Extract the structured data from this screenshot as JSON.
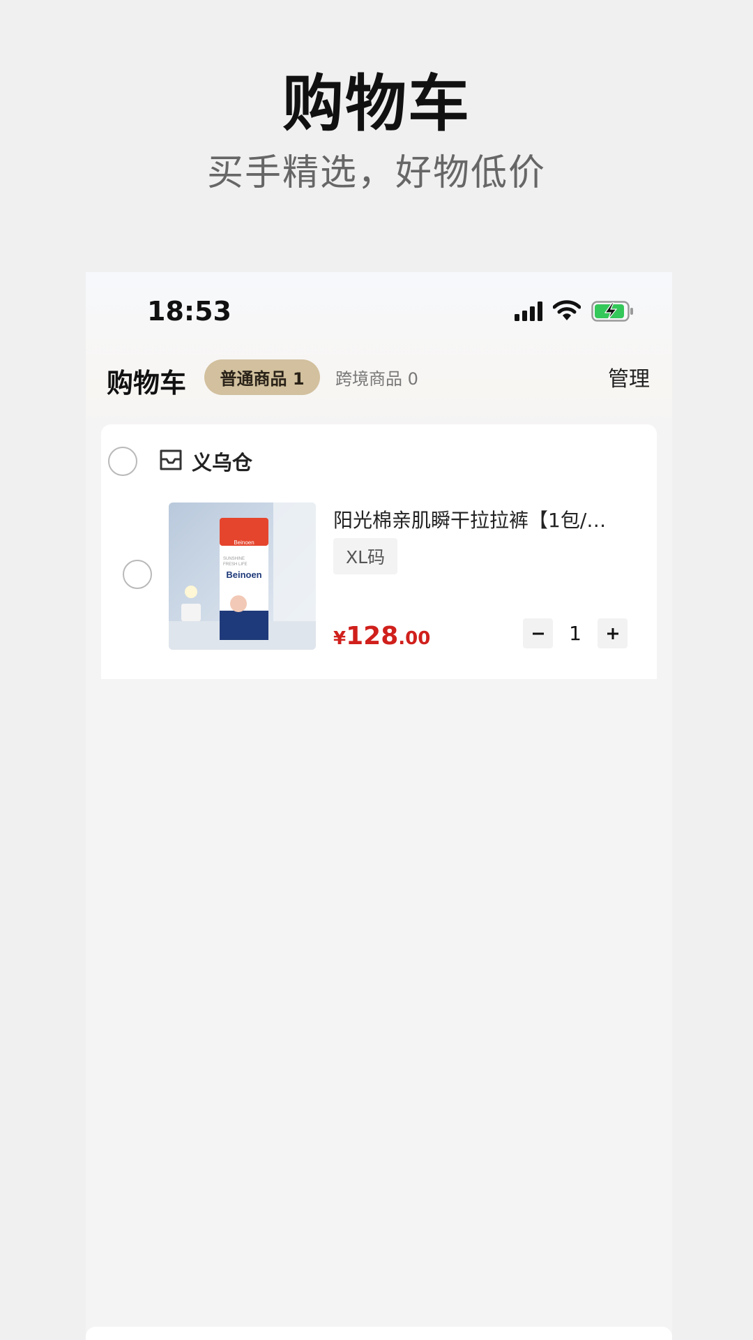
{
  "promo": {
    "title": "购物车",
    "subtitle": "买手精选，好物低价"
  },
  "status_bar": {
    "time": "18:53",
    "icons": [
      "signal-icon",
      "wifi-icon",
      "battery-charging-icon"
    ],
    "battery_color": "#34c759"
  },
  "nav": {
    "title": "购物车",
    "tabs": [
      {
        "label": "普通商品 1",
        "active": true
      },
      {
        "label": "跨境商品 0",
        "active": false
      }
    ],
    "manage_label": "管理"
  },
  "store": {
    "name": "义乌仓",
    "icon": "inbox-icon",
    "items": [
      {
        "name": "阳光棉亲肌瞬干拉拉裤【1包/…",
        "spec": "XL码",
        "price_symbol": "¥",
        "price_int": "128",
        "price_dec": ".00",
        "quantity": "1",
        "image_text": {
          "brand": "Beinoen",
          "line1": "SUNSHINE",
          "line2": "FRESH LIFE"
        }
      }
    ]
  },
  "colors": {
    "accent_tab": "#d2c09e",
    "price": "#d0201c"
  }
}
